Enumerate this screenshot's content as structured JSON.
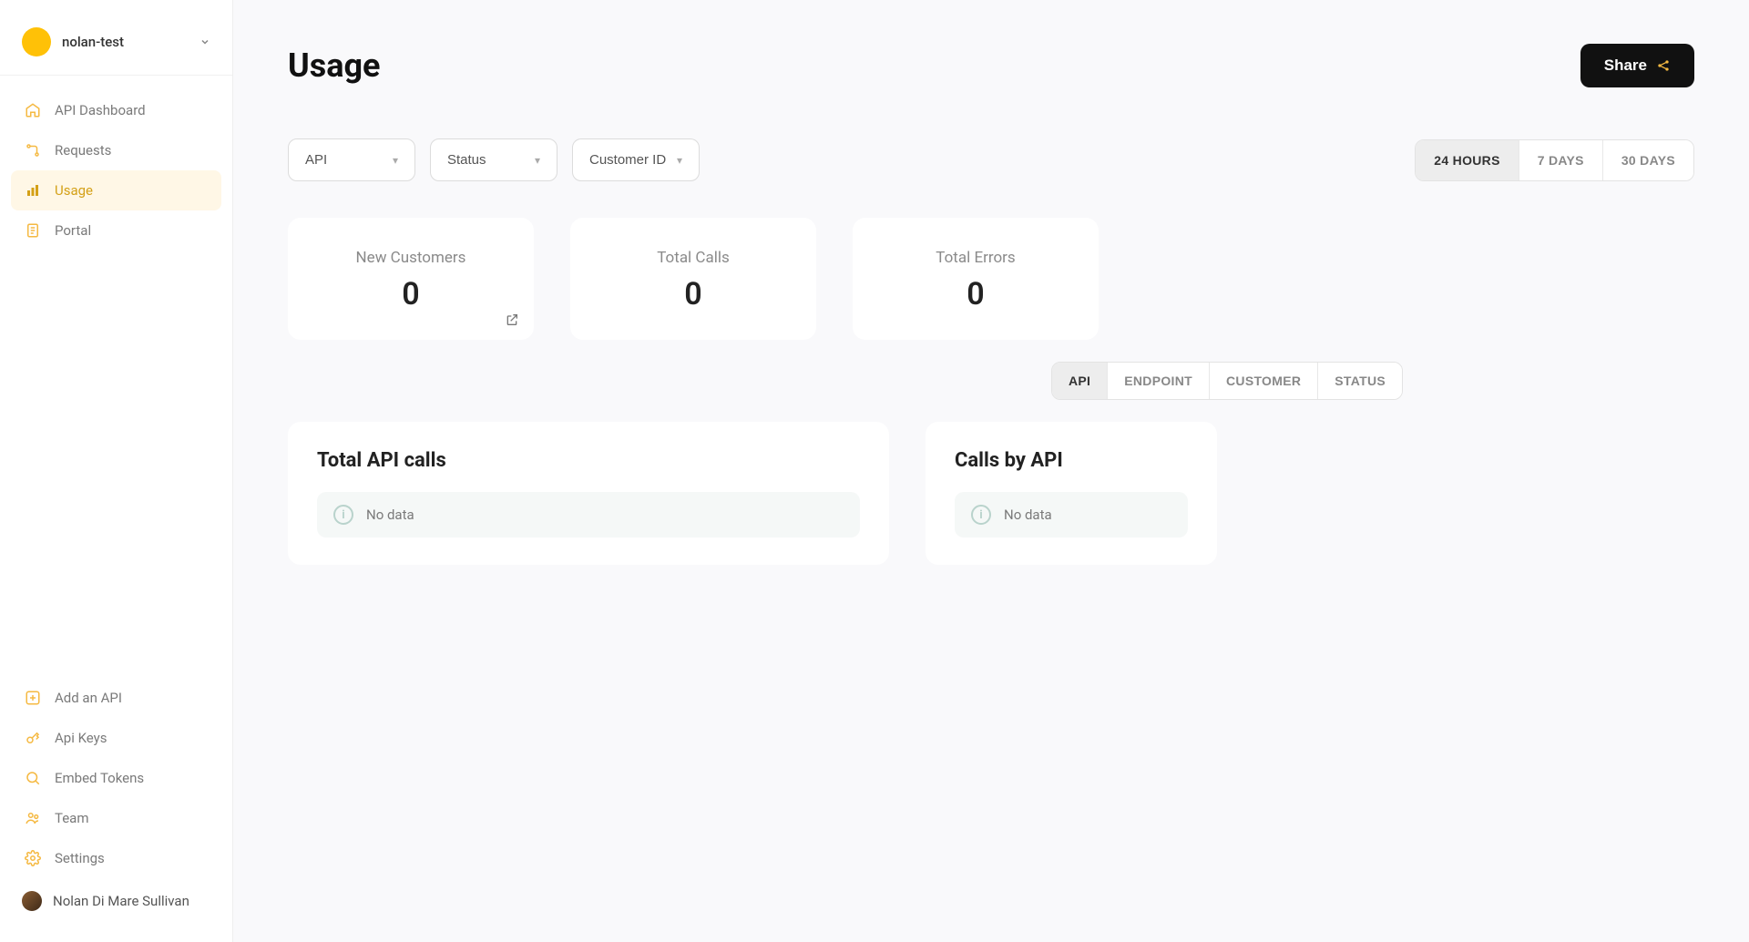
{
  "workspace": {
    "name": "nolan-test"
  },
  "sidebar": {
    "primary": [
      {
        "label": "API Dashboard"
      },
      {
        "label": "Requests"
      },
      {
        "label": "Usage"
      },
      {
        "label": "Portal"
      }
    ],
    "secondary": [
      {
        "label": "Add an API"
      },
      {
        "label": "Api Keys"
      },
      {
        "label": "Embed Tokens"
      },
      {
        "label": "Team"
      },
      {
        "label": "Settings"
      }
    ]
  },
  "user": {
    "name": "Nolan Di Mare Sullivan"
  },
  "page": {
    "title": "Usage",
    "share_label": "Share"
  },
  "filters": {
    "api": "API",
    "status": "Status",
    "customer_id": "Customer ID"
  },
  "ranges": [
    "24 HOURS",
    "7 DAYS",
    "30 DAYS"
  ],
  "active_range_index": 0,
  "stats": [
    {
      "label": "New Customers",
      "value": "0",
      "has_link": true
    },
    {
      "label": "Total Calls",
      "value": "0",
      "has_link": false
    },
    {
      "label": "Total Errors",
      "value": "0",
      "has_link": false
    }
  ],
  "group_tabs": [
    "API",
    "ENDPOINT",
    "CUSTOMER",
    "STATUS"
  ],
  "active_group_index": 0,
  "charts": {
    "total_api_calls": {
      "title": "Total API calls",
      "no_data": "No data"
    },
    "calls_by_api": {
      "title": "Calls by API",
      "no_data": "No data"
    }
  }
}
